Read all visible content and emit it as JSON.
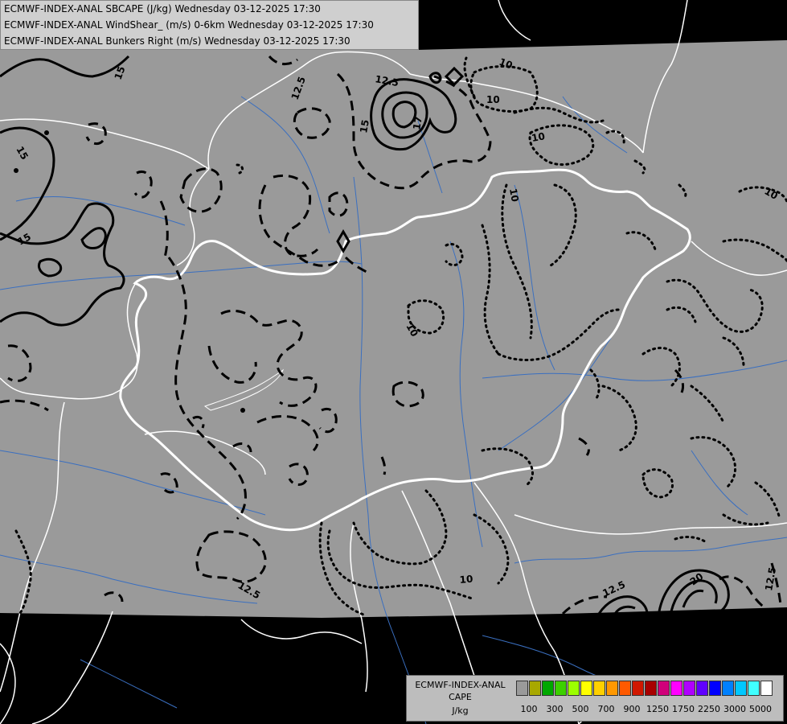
{
  "header": {
    "line1": "ECMWF-INDEX-ANAL SBCAPE (J/kg) Wednesday 03-12-2025 17:30",
    "line2": "ECMWF-INDEX-ANAL WindShear_ (m/s) 0-6km Wednesday 03-12-2025 17:30",
    "line3": "ECMWF-INDEX-ANAL Bunkers Right (m/s) Wednesday 03-12-2025 17:30"
  },
  "contour_labels": [
    "15",
    "15",
    "15",
    "12.5",
    "12.5",
    "17",
    "15",
    "10",
    "10",
    "10",
    "10",
    "10",
    "12.5",
    "12.5",
    "10",
    "12.5",
    "20"
  ],
  "legend": {
    "title_line1": "ECMWF-INDEX-ANAL",
    "title_line2": "CAPE",
    "title_line3": "J/kg",
    "colors": [
      "#9a9a9a",
      "#a8a800",
      "#00a800",
      "#3cd000",
      "#9cff00",
      "#ffff00",
      "#ffd000",
      "#ff9800",
      "#ff5a00",
      "#d01800",
      "#a80000",
      "#d0007a",
      "#ff00ff",
      "#b000ff",
      "#6000ff",
      "#0000ff",
      "#0080ff",
      "#00c8ff",
      "#40ffff",
      "#ffffff"
    ],
    "ticks": [
      "100",
      "300",
      "500",
      "700",
      "900",
      "1250",
      "1750",
      "2250",
      "3000",
      "5000"
    ]
  },
  "colors": {
    "domain_fill": "#9a9a9a",
    "outside": "#000000",
    "border": "#ffffff",
    "river": "#3a6fc0",
    "contour": "#000000"
  }
}
